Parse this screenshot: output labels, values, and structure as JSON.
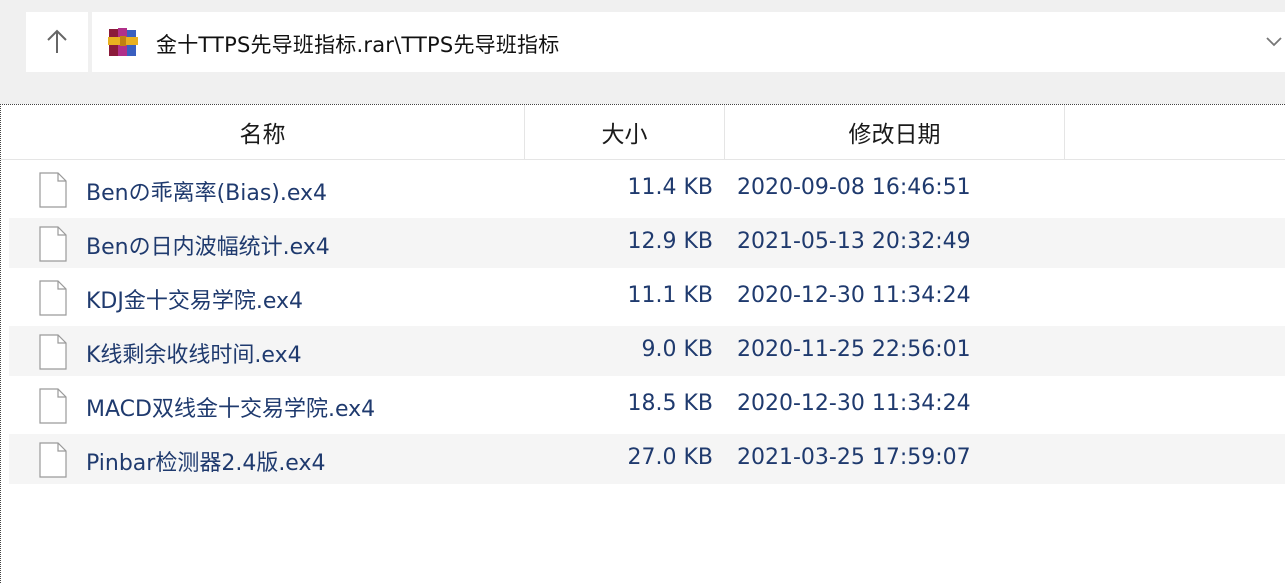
{
  "address": {
    "path": "金十TTPS先导班指标.rar\\TTPS先导班指标"
  },
  "columns": {
    "name": "名称",
    "size": "大小",
    "modified": "修改日期"
  },
  "files": [
    {
      "name": "Benの乖离率(Bias).ex4",
      "size": "11.4 KB",
      "modified": "2020-09-08 16:46:51"
    },
    {
      "name": "Benの日内波幅统计.ex4",
      "size": "12.9 KB",
      "modified": "2021-05-13 20:32:49"
    },
    {
      "name": "KDJ金十交易学院.ex4",
      "size": "11.1 KB",
      "modified": "2020-12-30 11:34:24"
    },
    {
      "name": "K线剩余收线时间.ex4",
      "size": "9.0 KB",
      "modified": "2020-11-25 22:56:01"
    },
    {
      "name": "MACD双线金十交易学院.ex4",
      "size": "18.5 KB",
      "modified": "2020-12-30 11:34:24"
    },
    {
      "name": "Pinbar检测器2.4版.ex4",
      "size": "27.0 KB",
      "modified": "2021-03-25 17:59:07"
    }
  ],
  "colors": {
    "text": "#1f3a6e",
    "alt_row": "#f5f5f5",
    "chrome": "#f0f0f0"
  },
  "icons": {
    "up": "arrow-up-icon",
    "archive": "winrar-archive-icon",
    "file": "file-icon",
    "dropdown": "chevron-down-icon"
  }
}
